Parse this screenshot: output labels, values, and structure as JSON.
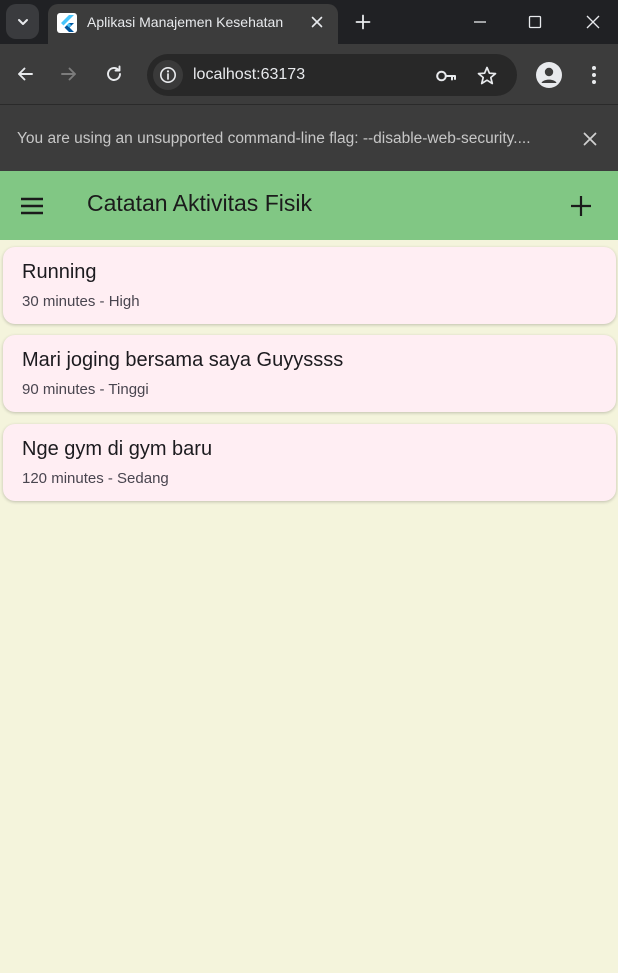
{
  "browser": {
    "tab_title": "Aplikasi Manajemen Kesehatan",
    "url": "localhost:63173",
    "infobar_message": "You are using an unsupported command-line flag: --disable-web-security...."
  },
  "app": {
    "title": "Catatan Aktivitas Fisik",
    "background_color": "#f4f4dc",
    "appbar_color": "#81c784",
    "card_color": "#ffeef3"
  },
  "activities": [
    {
      "name": "Running",
      "details": "30 minutes - High"
    },
    {
      "name": "Mari joging bersama saya Guyyssss",
      "details": "90 minutes - Tinggi"
    },
    {
      "name": "Nge gym di gym baru",
      "details": "120 minutes - Sedang"
    }
  ],
  "icons": {
    "tab_search": "chevron-down-icon",
    "favicon": "flutter-icon",
    "tab_close": "close-icon",
    "new_tab": "plus-icon",
    "minimize": "minimize-icon",
    "maximize": "maximize-icon",
    "window_close": "close-icon",
    "back": "arrow-left-icon",
    "forward": "arrow-right-icon",
    "reload": "reload-icon",
    "site_info": "info-icon",
    "passwords": "key-icon",
    "bookmark": "star-icon",
    "profile": "person-icon",
    "menu": "kebab-menu-icon",
    "drawer": "hamburger-icon",
    "add": "plus-icon"
  }
}
